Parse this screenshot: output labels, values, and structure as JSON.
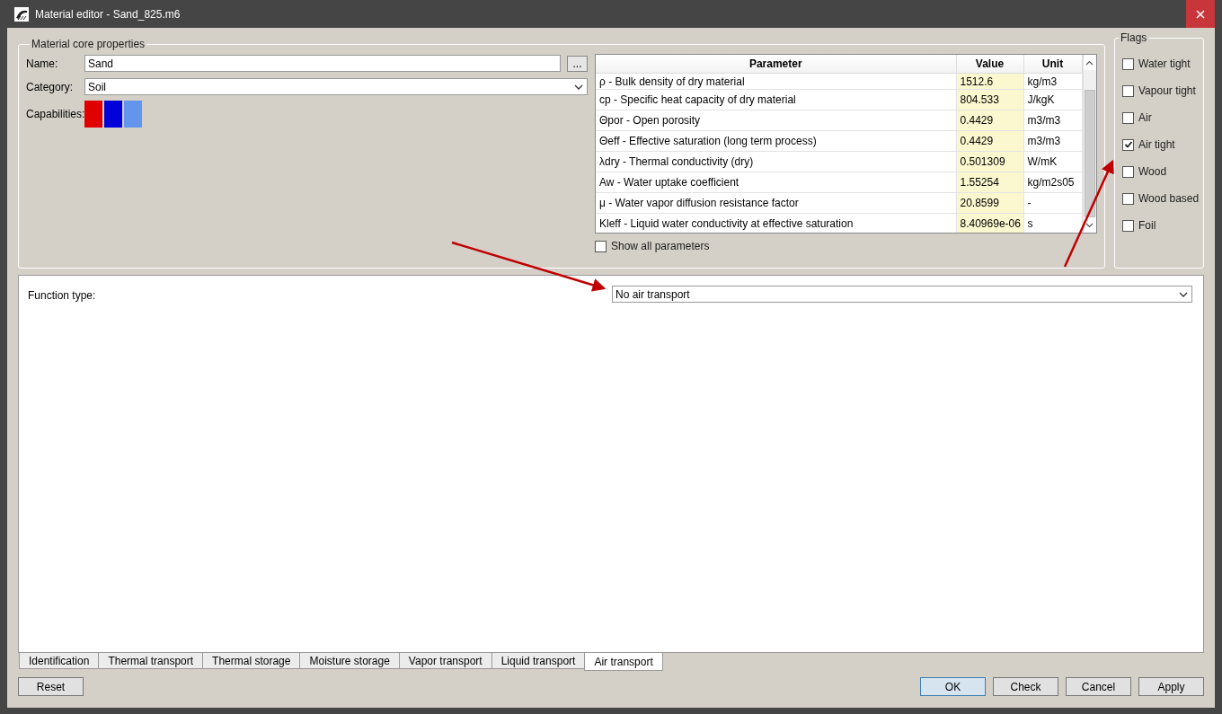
{
  "window": {
    "title": "Material editor - Sand_825.m6"
  },
  "core_properties": {
    "title": "Material core properties",
    "name_label": "Name:",
    "name_value": "Sand",
    "browse_button": "...",
    "category_label": "Category:",
    "category_value": "Soil",
    "capabilities_label": "Capabilities:",
    "capabilities": [
      {
        "color": "#e00000"
      },
      {
        "color": "#0000d8"
      },
      {
        "color": "#6495ed"
      }
    ],
    "parameters_table": {
      "columns": [
        "Parameter",
        "Value",
        "Unit"
      ],
      "rows": [
        [
          "ρ - Bulk density of dry material",
          "1512.6",
          "kg/m3"
        ],
        [
          "cp - Specific heat capacity of dry material",
          "804.533",
          "J/kgK"
        ],
        [
          "Θpor - Open porosity",
          "0.4429",
          "m3/m3"
        ],
        [
          "Θeff - Effective saturation (long term process)",
          "0.4429",
          "m3/m3"
        ],
        [
          "λdry - Thermal conductivity (dry)",
          "0.501309",
          "W/mK"
        ],
        [
          "Aw - Water uptake coefficient",
          "1.55254",
          "kg/m2s05"
        ],
        [
          "μ - Water vapor diffusion resistance factor",
          "20.8599",
          "-"
        ],
        [
          "Kleff - Liquid water conductivity at effective saturation",
          "8.40969e-06",
          "s"
        ]
      ]
    },
    "show_all": {
      "label": "Show all parameters",
      "checked": false
    }
  },
  "flags": {
    "title": "Flags",
    "items": [
      {
        "label": "Water tight",
        "checked": false
      },
      {
        "label": "Vapour tight",
        "checked": false
      },
      {
        "label": "Air",
        "checked": false
      },
      {
        "label": "Air tight",
        "checked": true
      },
      {
        "label": "Wood",
        "checked": false
      },
      {
        "label": "Wood based",
        "checked": false
      },
      {
        "label": "Foil",
        "checked": false
      }
    ]
  },
  "function_type": {
    "label": "Function type:",
    "value": "No air transport"
  },
  "tabs": [
    {
      "label": "Identification",
      "selected": false
    },
    {
      "label": "Thermal transport",
      "selected": false
    },
    {
      "label": "Thermal storage",
      "selected": false
    },
    {
      "label": "Moisture storage",
      "selected": false
    },
    {
      "label": "Vapor transport",
      "selected": false
    },
    {
      "label": "Liquid transport",
      "selected": false
    },
    {
      "label": "Air transport",
      "selected": true
    }
  ],
  "reset_button": "Reset",
  "buttons": [
    {
      "label": "OK",
      "default": true
    },
    {
      "label": "Check",
      "default": false
    },
    {
      "label": "Cancel",
      "default": false
    },
    {
      "label": "Apply",
      "default": false
    }
  ]
}
